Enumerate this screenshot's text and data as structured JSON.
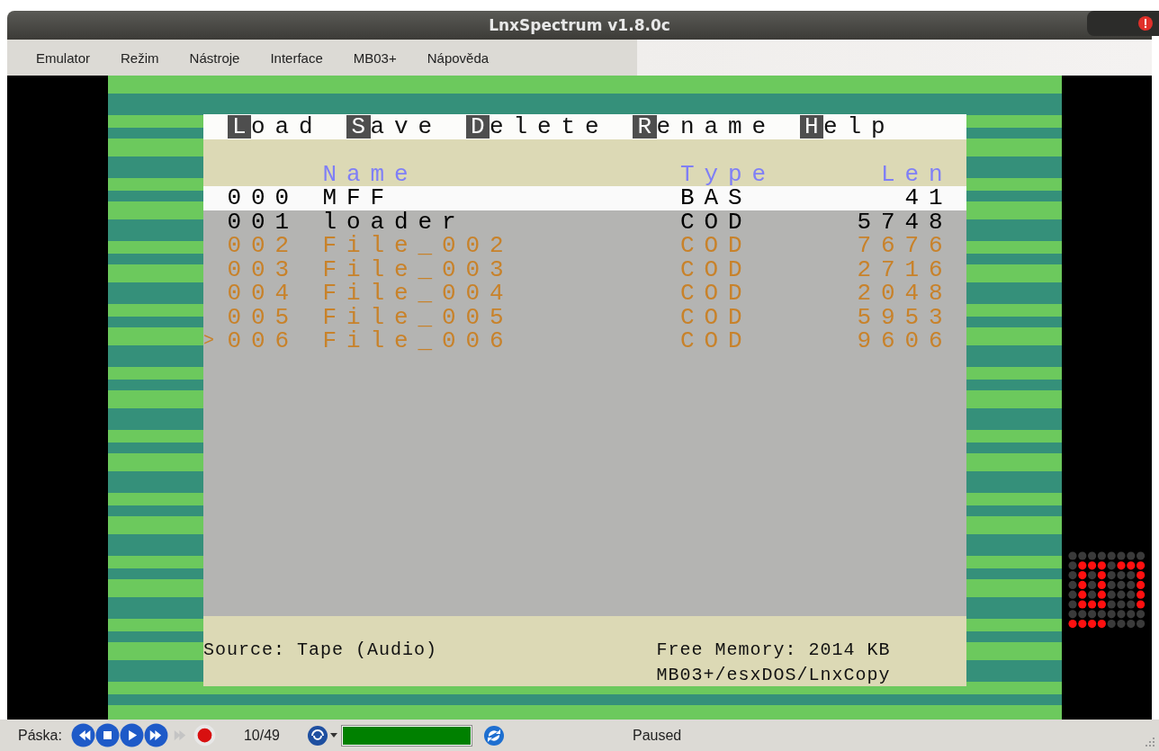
{
  "window": {
    "title": "LnxSpectrum v1.8.0c"
  },
  "menu": [
    "Emulator",
    "Režim",
    "Nástroje",
    "Interface",
    "MB03+",
    "Nápověda"
  ],
  "screen": {
    "commands": [
      {
        "hotkey": "L",
        "label": "oad"
      },
      {
        "hotkey": "S",
        "label": "ave"
      },
      {
        "hotkey": "D",
        "label": "elete"
      },
      {
        "hotkey": "R",
        "label": "ename"
      },
      {
        "hotkey": "H",
        "label": "elp"
      }
    ],
    "columns": [
      "Name",
      "Type",
      "Len"
    ],
    "files": [
      {
        "index": "000",
        "name": "MFF",
        "type": "BAS",
        "len": "41",
        "selected": true,
        "color": "#000000"
      },
      {
        "index": "001",
        "name": "loader",
        "type": "COD",
        "len": "5748",
        "selected": false,
        "color": "#000000"
      },
      {
        "index": "002",
        "name": "File_002",
        "type": "COD",
        "len": "7676",
        "selected": false,
        "color": "#c8822a"
      },
      {
        "index": "003",
        "name": "File_003",
        "type": "COD",
        "len": "2716",
        "selected": false,
        "color": "#c8822a"
      },
      {
        "index": "004",
        "name": "File_004",
        "type": "COD",
        "len": "2048",
        "selected": false,
        "color": "#c8822a"
      },
      {
        "index": "005",
        "name": "File_005",
        "type": "COD",
        "len": "5953",
        "selected": false,
        "color": "#c8822a"
      },
      {
        "cursor": ">",
        "index": "006",
        "name": "File_006",
        "type": "COD",
        "len": "9606",
        "selected": false,
        "color": "#c8822a"
      }
    ],
    "source": "Source: Tape (Audio)",
    "free_memory": "Free Memory: 2014 KB",
    "path": "MB03+/esxDOS/LnxCopy"
  },
  "status_bar": {
    "label": "Páska:",
    "buttons": [
      {
        "kind": "rewind",
        "disabled": false
      },
      {
        "kind": "stop",
        "disabled": false
      },
      {
        "kind": "play",
        "disabled": false
      },
      {
        "kind": "forward",
        "disabled": false
      },
      {
        "kind": "skip",
        "disabled": true
      },
      {
        "kind": "record",
        "disabled": false
      }
    ],
    "counter": "10/49",
    "progress": {
      "level": 1
    },
    "status": "Paused"
  }
}
